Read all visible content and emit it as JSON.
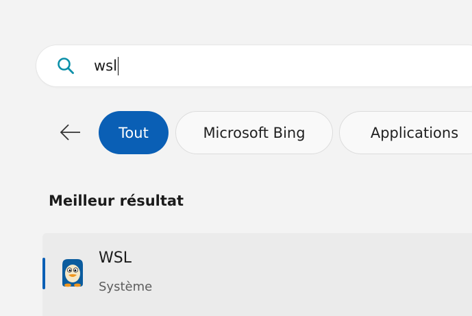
{
  "search": {
    "query": "wsl",
    "icon": "search-icon",
    "accent_color": "#0a8fa8"
  },
  "filters": {
    "back_icon": "back-arrow-icon",
    "chips": [
      {
        "label": "Tout",
        "active": true
      },
      {
        "label": "Microsoft Bing",
        "active": false
      },
      {
        "label": "Applications",
        "active": false
      }
    ],
    "active_color": "#0a5fb5"
  },
  "best_match": {
    "section_title": "Meilleur résultat",
    "result": {
      "name": "WSL",
      "type": "Système",
      "icon": "wsl-penguin-icon"
    }
  }
}
